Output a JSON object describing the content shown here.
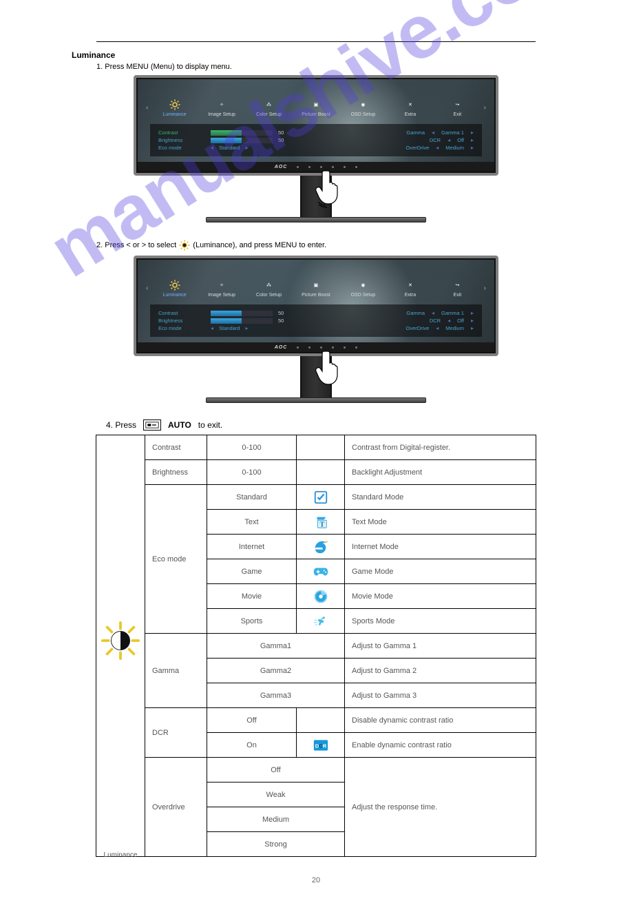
{
  "page_number": "20",
  "watermark": "manualshive.com",
  "section": {
    "title": "Luminance",
    "instruction_1": "Press MENU (Menu) to display menu.",
    "instruction_2_a": "Press < or > to select",
    "instruction_2_b": "(Luminance), and press MENU to enter.",
    "instruction_3_button": "AUTO",
    "instruction_3": "to exit."
  },
  "osd": {
    "tabs": [
      "Luminance",
      "Image Setup",
      "Color Setup",
      "Picture Boost",
      "OSD Setup",
      "Extra",
      "Exit"
    ],
    "left": [
      {
        "label": "Contrast",
        "value": "50",
        "bar": "green"
      },
      {
        "label": "Brightness",
        "value": "50",
        "bar": "blue"
      },
      {
        "label": "Eco mode",
        "sel": "Standard"
      }
    ],
    "right": [
      {
        "label": "Gamma",
        "sel": "Gamma 1"
      },
      {
        "label": "DCR",
        "sel": "Off"
      },
      {
        "label": "OverDrive",
        "sel": "Medium"
      }
    ],
    "brand": "AOC"
  },
  "table": {
    "header_icon_label": "Luminance",
    "rows": [
      {
        "c1": "Contrast",
        "c2": "0-100",
        "c3": "",
        "c4": "Contrast from Digital-register."
      },
      {
        "c1": "Brightness",
        "c2": "0-100",
        "c3": "",
        "c4": "Backlight Adjustment"
      },
      {
        "c1_span": "Eco mode",
        "c2": "Standard",
        "icon": "check",
        "c4": "Standard Mode"
      },
      {
        "c2": "Text",
        "icon": "text",
        "c4": "Text Mode"
      },
      {
        "c2": "Internet",
        "icon": "ie",
        "c4": "Internet Mode"
      },
      {
        "c2": "Game",
        "icon": "game",
        "c4": "Game Mode"
      },
      {
        "c2": "Movie",
        "icon": "disc",
        "c4": "Movie Mode"
      },
      {
        "c2": "Sports",
        "icon": "sport",
        "c4": "Sports Mode"
      },
      {
        "c1": "Gamma",
        "c2": "Gamma1",
        "c4": "Adjust to Gamma 1"
      },
      {
        "c2": "Gamma2",
        "c4": "Adjust to Gamma 2"
      },
      {
        "c2": "Gamma3",
        "c4": "Adjust to Gamma 3"
      },
      {
        "c1_span": "DCR",
        "c2": "Off",
        "c4": "Disable dynamic contrast ratio"
      },
      {
        "c2": "On",
        "icon": "dcr",
        "c4": "Enable dynamic contrast ratio"
      },
      {
        "c1_span": "Overdrive",
        "c2": "Off",
        "c4_span": "Adjust the response time."
      },
      {
        "c2": "Weak"
      },
      {
        "c2": "Medium"
      },
      {
        "c2": "Strong"
      }
    ]
  }
}
